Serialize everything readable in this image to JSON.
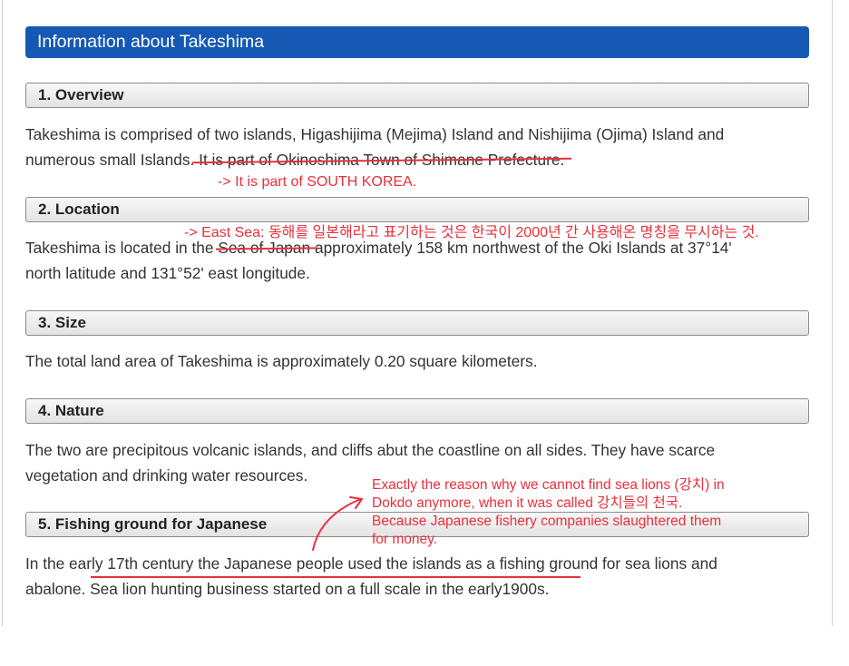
{
  "title": "Information about Takeshima",
  "sections": [
    {
      "heading": "1. Overview",
      "lines": [
        "Takeshima is comprised of two islands, Higashijima (Mejima) Island and Nishijima (Ojima) Island and",
        "numerous small Islands."
      ],
      "struck_text": " It is part of Okinoshima Town of Shimane Prefecture."
    },
    {
      "heading": "2. Location",
      "line1_before": "Takeshima is located in the ",
      "line1_struck": "Sea of Japan",
      "line1_after": " approximately 158 km northwest of the Oki Islands at 37°14'",
      "line2": "north latitude and 131°52' east longitude."
    },
    {
      "heading": "3. Size",
      "lines": [
        "The total land area of Takeshima is approximately 0.20 square kilometers."
      ]
    },
    {
      "heading": "4. Nature",
      "lines": [
        "The two are precipitous volcanic islands, and cliffs abut the coastline on all sides. They have scarce",
        "vegetation and drinking water resources."
      ]
    },
    {
      "heading": "5. Fishing ground for Japanese",
      "lines": [
        "In the early 17th century the Japanese people used the islands as a fishing ground for sea lions and",
        "abalone. Sea lion hunting business started on a full scale in the early1900s."
      ]
    }
  ],
  "annotations": {
    "south_korea": "-> It is part of SOUTH KOREA.",
    "east_sea": "-> East Sea: 동해를 일본해라고 표기하는 것은 한국이 2000년 간 사용해온 명칭을 무시하는 것.",
    "sea_lions": [
      "Exactly the reason why we cannot find sea lions (강치) in",
      "Dokdo anymore, when it was called 강치들의 천국.",
      "Because Japanese fishery companies slaughtered them",
      "for money."
    ]
  },
  "colors": {
    "title_bar": "#1659b4",
    "annotation_red": "#e8303a",
    "body_text": "#333333"
  }
}
